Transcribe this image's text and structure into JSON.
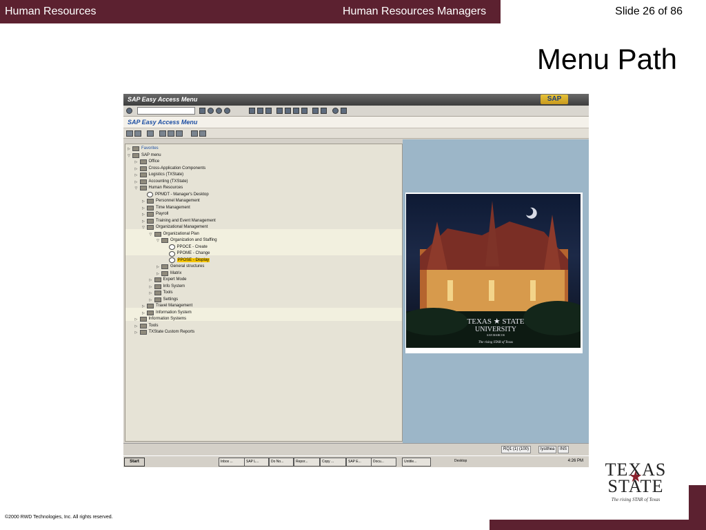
{
  "slide": {
    "header_left": "Human Resources",
    "header_center": "Human Resources Managers",
    "header_right": "Slide 26 of 86",
    "title": "Menu Path",
    "footer": "©2000 RWD Technologies, Inc.  All rights reserved.",
    "maroon": "#5c2130"
  },
  "logo": {
    "line1": "TEXAS",
    "line2": "STATE",
    "tagline": "The rising STAR of Texas"
  },
  "sap": {
    "window_title": "SAP Easy Access  Menu",
    "app_title": "SAP Easy Access  Menu",
    "logo": "SAP",
    "tree": [
      {
        "label": "Favorites",
        "level": 0,
        "state": "collapsed",
        "icon": "folder",
        "color": "blue"
      },
      {
        "label": "SAP menu",
        "level": 0,
        "state": "expanded",
        "icon": "folder"
      },
      {
        "label": "Office",
        "level": 1,
        "state": "collapsed",
        "icon": "folder"
      },
      {
        "label": "Cross-Application Components",
        "level": 1,
        "state": "collapsed",
        "icon": "folder"
      },
      {
        "label": "Logistics (TXState)",
        "level": 1,
        "state": "collapsed",
        "icon": "folder"
      },
      {
        "label": "Accounting (TXState)",
        "level": 1,
        "state": "collapsed",
        "icon": "folder"
      },
      {
        "label": "Human Resources",
        "level": 1,
        "state": "expanded",
        "icon": "folder"
      },
      {
        "label": "PPMDT - Manager's Desktop",
        "level": 2,
        "state": "leaf",
        "icon": "transaction"
      },
      {
        "label": "Personnel Management",
        "level": 2,
        "state": "collapsed",
        "icon": "folder"
      },
      {
        "label": "Time Management",
        "level": 2,
        "state": "collapsed",
        "icon": "folder"
      },
      {
        "label": "Payroll",
        "level": 2,
        "state": "collapsed",
        "icon": "folder"
      },
      {
        "label": "Training and Event Management",
        "level": 2,
        "state": "collapsed",
        "icon": "folder"
      },
      {
        "label": "Organizational Management",
        "level": 2,
        "state": "expanded",
        "icon": "folder"
      },
      {
        "label": "Organizational Plan",
        "level": 3,
        "state": "expanded",
        "icon": "folder"
      },
      {
        "label": "Organization and Staffing",
        "level": 4,
        "state": "expanded",
        "icon": "folder"
      },
      {
        "label": "PPOCE - Create",
        "level": 5,
        "state": "leaf",
        "icon": "transaction"
      },
      {
        "label": "PPOME - Change",
        "level": 5,
        "state": "leaf",
        "icon": "transaction"
      },
      {
        "label": "PPOSE - Display",
        "level": 5,
        "state": "leaf",
        "icon": "transaction",
        "highlight": true
      },
      {
        "label": "General structures",
        "level": 4,
        "state": "collapsed",
        "icon": "folder"
      },
      {
        "label": "Matrix",
        "level": 4,
        "state": "collapsed",
        "icon": "folder"
      },
      {
        "label": "Expert Mode",
        "level": 3,
        "state": "collapsed",
        "icon": "folder"
      },
      {
        "label": "Info System",
        "level": 3,
        "state": "collapsed",
        "icon": "folder"
      },
      {
        "label": "Tools",
        "level": 3,
        "state": "collapsed",
        "icon": "folder"
      },
      {
        "label": "Settings",
        "level": 3,
        "state": "collapsed",
        "icon": "folder"
      },
      {
        "label": "Travel Management",
        "level": 2,
        "state": "collapsed",
        "icon": "folder"
      },
      {
        "label": "Information System",
        "level": 2,
        "state": "collapsed",
        "icon": "folder"
      },
      {
        "label": "Information Systems",
        "level": 1,
        "state": "collapsed",
        "icon": "folder"
      },
      {
        "label": "Tools",
        "level": 1,
        "state": "collapsed",
        "icon": "folder"
      },
      {
        "label": "TXState Custom Reports",
        "level": 1,
        "state": "collapsed",
        "icon": "folder"
      }
    ],
    "photo": {
      "line1": "TEXAS ★ STATE",
      "line2": "UNIVERSITY",
      "line3": "SAN MARCOS",
      "line4": "The rising STAR of Texas"
    },
    "status": {
      "system": "RQ1 (1) (100)",
      "server": "lysithea",
      "mode": "INS"
    },
    "taskbar": {
      "start": "Start",
      "buttons": [
        "Inbox ...",
        "SAP L...",
        "Do No...",
        "Repor...",
        "Copy ...",
        "SAP E...",
        "Docu...",
        "Untitle..."
      ],
      "desktop": "Desktop",
      "clock": "4:26 PM"
    }
  }
}
